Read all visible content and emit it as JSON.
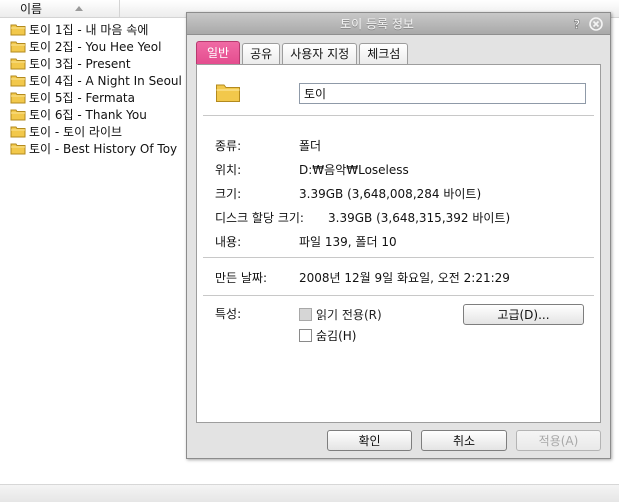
{
  "explorer": {
    "column_header": "이름",
    "items": [
      "토이 1집 - 내 마음 속에",
      "토이 2집 - You Hee Yeol",
      "토이 3집 - Present",
      "토이 4집 - A Night In Seoul",
      "토이 5집 - Fermata",
      "토이 6집 - Thank You",
      "토이 - 토이 라이브",
      "토이 - Best History Of Toy"
    ]
  },
  "dialog": {
    "title": "토이 등록 정보",
    "tabs": [
      "일반",
      "공유",
      "사용자 지정",
      "체크섬"
    ],
    "active_tab": 0,
    "name_value": "토이",
    "rows": {
      "type": {
        "label": "종류:",
        "value": "폴더"
      },
      "location": {
        "label": "위치:",
        "value": "D:₩음악₩Loseless"
      },
      "size": {
        "label": "크기:",
        "value": "3.39GB (3,648,008,284 바이트)"
      },
      "disk_size": {
        "label": "디스크 할당 크기:",
        "value": "3.39GB (3,648,315,392 바이트)"
      },
      "contents": {
        "label": "내용:",
        "value": "파일 139, 폴더 10"
      },
      "created": {
        "label": "만든 날짜:",
        "value": "2008년 12월 9일 화요일, 오전 2:21:29"
      }
    },
    "attributes": {
      "label": "특성:",
      "readonly": "읽기 전용(R)",
      "hidden": "숨김(H)",
      "advanced_button": "고급(D)..."
    },
    "buttons": {
      "ok": "확인",
      "cancel": "취소",
      "apply": "적용(A)"
    }
  },
  "colors": {
    "active_tab": "#e44d8f",
    "folder": "#f2c84b",
    "titlebar": "#b5b5b5"
  }
}
